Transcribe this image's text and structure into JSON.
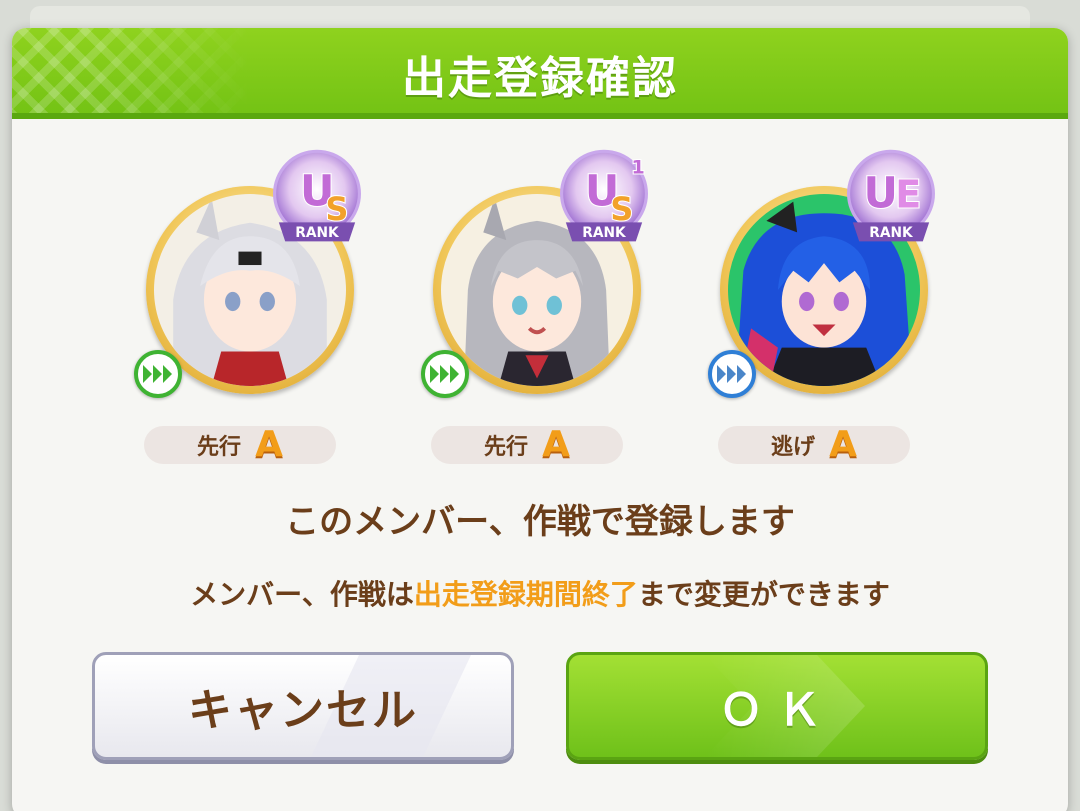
{
  "dialog": {
    "title": "出走登録確認",
    "confirm_text": "このメンバー、作戦で登録します",
    "note_prefix": "メンバー、作戦は",
    "note_highlight": "出走登録期間終了",
    "note_suffix": "まで変更ができます"
  },
  "members": [
    {
      "rank": "US",
      "rank_sup": "",
      "rank_label": "RANK",
      "strategy": "先行",
      "grade": "A",
      "run_icon": "green-forward-icon",
      "hair": "#d9d9dd"
    },
    {
      "rank": "US",
      "rank_sup": "1",
      "rank_label": "RANK",
      "strategy": "先行",
      "grade": "A",
      "run_icon": "green-forward-icon",
      "hair": "#bdbdc3"
    },
    {
      "rank": "UE",
      "rank_sup": "",
      "rank_label": "RANK",
      "strategy": "逃げ",
      "grade": "A",
      "run_icon": "blue-forward-icon",
      "hair": "#1a4fd6"
    }
  ],
  "buttons": {
    "cancel_label": "キャンセル",
    "ok_label": "ＯＫ"
  },
  "colors": {
    "header_green": "#7dca17",
    "text_brown": "#6b3e1a",
    "highlight_orange": "#f29d19"
  }
}
